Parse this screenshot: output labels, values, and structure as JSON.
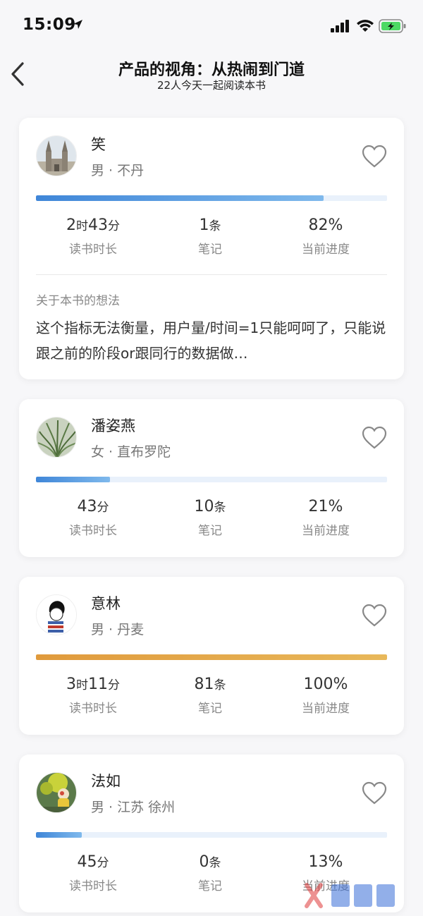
{
  "status_bar": {
    "time": "15:09"
  },
  "header": {
    "title": "产品的视角：从热闹到门道",
    "subtitle": "22人今天一起阅读本书"
  },
  "labels": {
    "reading_time": "读书时长",
    "notes": "笔记",
    "progress": "当前进度"
  },
  "readers": [
    {
      "name": "笑",
      "info": "男 · 不丹",
      "time_main": "2",
      "time_unit1": "时",
      "time_main2": "43",
      "time_unit2": "分",
      "notes_count": "1",
      "notes_unit": "条",
      "progress_text": "82%",
      "progress_value": 0.82,
      "bar_color_start": "#3f86d8",
      "bar_color_end": "#7fb9ec",
      "thoughts_label": "关于本书的想法",
      "thoughts_text": "这个指标无法衡量，用户量/时间=1只能呵呵了，只能说跟之前的阶段or跟同行的数据做…"
    },
    {
      "name": "潘姿燕",
      "info": "女 · 直布罗陀",
      "time_main": "43",
      "time_unit1": "分",
      "time_main2": "",
      "time_unit2": "",
      "notes_count": "10",
      "notes_unit": "条",
      "progress_text": "21%",
      "progress_value": 0.21,
      "bar_color_start": "#3f86d8",
      "bar_color_end": "#7fb9ec"
    },
    {
      "name": "意林",
      "info": "男 · 丹麦",
      "time_main": "3",
      "time_unit1": "时",
      "time_main2": "11",
      "time_unit2": "分",
      "notes_count": "81",
      "notes_unit": "条",
      "progress_text": "100%",
      "progress_value": 1.0,
      "bar_color_start": "#e09a3c",
      "bar_color_end": "#e8b85a"
    },
    {
      "name": "法如",
      "info": "男 · 江苏 徐州",
      "time_main": "45",
      "time_unit1": "分",
      "time_main2": "",
      "time_unit2": "",
      "notes_count": "0",
      "notes_unit": "条",
      "progress_text": "13%",
      "progress_value": 0.13,
      "bar_color_start": "#3f86d8",
      "bar_color_end": "#7fb9ec"
    }
  ],
  "icons": {
    "back": "chevron-left-icon",
    "like": "heart-outline-icon",
    "location": "location-arrow-icon",
    "signal": "cellular-signal-icon",
    "wifi": "wifi-icon",
    "battery": "battery-charging-icon"
  }
}
